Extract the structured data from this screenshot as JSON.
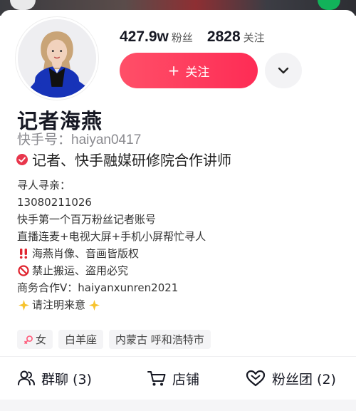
{
  "profile": {
    "name": "记者海燕",
    "uid": "快手号：haiyan0417",
    "verified_text": "记者、快手融媒研修院合作讲师",
    "avatar_icon": "avatar-photo"
  },
  "stats": {
    "followers_value": "427.9w",
    "followers_label": "粉丝",
    "following_value": "2828",
    "following_label": "关注"
  },
  "buttons": {
    "follow_label": "关注",
    "follow_icon": "plus-icon",
    "more_icon": "chevron-down-icon"
  },
  "bio": [
    {
      "text": "寻人寻亲：",
      "icon": ""
    },
    {
      "text": "13080211026",
      "icon": ""
    },
    {
      "text": "快手第一个百万粉丝记者账号",
      "icon": ""
    },
    {
      "text": "直播连麦+电视大屏+手机小屏帮忙寻人",
      "icon": ""
    },
    {
      "text": "海燕肖像、音画皆版权",
      "icon": "double-exclamation-icon"
    },
    {
      "text": "禁止搬运、盗用必究",
      "icon": "prohibited-icon"
    },
    {
      "text": "商务合作V：haiyanxunren2021",
      "icon": ""
    },
    {
      "text": "请注明来意",
      "icon": "sparkle-star-icon",
      "trailing_icon": "sparkle-star-icon"
    }
  ],
  "tags": {
    "gender": "女",
    "gender_icon": "female-icon",
    "zodiac": "白羊座",
    "location": "内蒙古 呼和浩特市"
  },
  "actions": {
    "group_chat": "群聊 (3)",
    "group_chat_icon": "group-icon",
    "shop": "店铺",
    "shop_icon": "cart-icon",
    "fan_club": "粉丝团 (2)",
    "fan_club_icon": "heart-icon"
  },
  "colors": {
    "accent": "#fe2c55",
    "text_primary": "#161823",
    "text_secondary": "#8a8a8f",
    "verified_badge": "#e8364c"
  }
}
